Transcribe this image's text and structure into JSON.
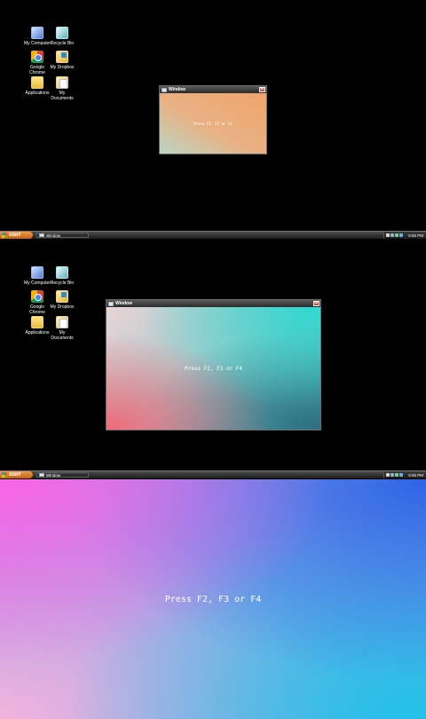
{
  "desktop_icons": {
    "my_computer": "My Computer",
    "recycle_bin": "Recycle Bin",
    "google_chrome": "Google Chrome",
    "my_dropbox": "My Dropbox",
    "applications": "Applications",
    "my_documents": "My Documents"
  },
  "window": {
    "title": "Window",
    "close": "×",
    "message": "Press F2, F3 or F4"
  },
  "taskbar": {
    "start_label": "start",
    "task_label": "Window",
    "clock": "6:55 PM"
  },
  "fullscreen": {
    "message": "Press F2, F3 or F4"
  }
}
